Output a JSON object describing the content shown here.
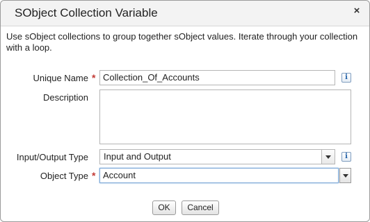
{
  "dialog": {
    "title": "SObject Collection Variable",
    "close_glyph": "×",
    "description": "Use sObject collections to group together sObject values. Iterate through your collection with a loop."
  },
  "form": {
    "unique_name": {
      "label": "Unique Name",
      "required_mark": "*",
      "value": "Collection_Of_Accounts",
      "info_glyph": "i"
    },
    "description": {
      "label": "Description",
      "value": ""
    },
    "io_type": {
      "label": "Input/Output Type",
      "selected": "Input and Output",
      "info_glyph": "i"
    },
    "object_type": {
      "label": "Object Type",
      "required_mark": "*",
      "value": "Account"
    }
  },
  "buttons": {
    "ok_label": "OK",
    "cancel_label": "Cancel"
  },
  "colors": {
    "required": "#c23934",
    "focus_border": "#7aa7d6",
    "info_icon": "#1f5fa7"
  }
}
